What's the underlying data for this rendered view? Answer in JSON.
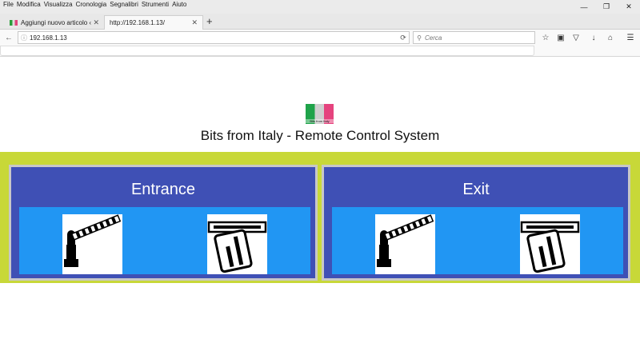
{
  "browser": {
    "menu": [
      {
        "label": "File"
      },
      {
        "label": "Modifica"
      },
      {
        "label": "Visualizza"
      },
      {
        "label": "Cronologia"
      },
      {
        "label": "Segnalibri"
      },
      {
        "label": "Strumenti"
      },
      {
        "label": "Aiuto"
      }
    ],
    "tabs": [
      {
        "title": "Aggiungi nuovo articolo ‹ ..."
      },
      {
        "title": "http://192.168.1.13/"
      }
    ],
    "address": "192.168.1.13",
    "search_placeholder": "Cerca"
  },
  "page": {
    "logo_text": "Bits from Italy",
    "title": "Bits from Italy - Remote Control System",
    "panels": [
      {
        "title": "Entrance",
        "buttons": [
          {
            "icon": "barrier-gate-icon"
          },
          {
            "icon": "card-reader-icon"
          }
        ]
      },
      {
        "title": "Exit",
        "buttons": [
          {
            "icon": "barrier-gate-icon"
          },
          {
            "icon": "card-reader-icon"
          }
        ]
      }
    ]
  },
  "colors": {
    "band": "#c8d838",
    "panel_bg": "#3f50b5",
    "button_strip": "#2196f3"
  }
}
